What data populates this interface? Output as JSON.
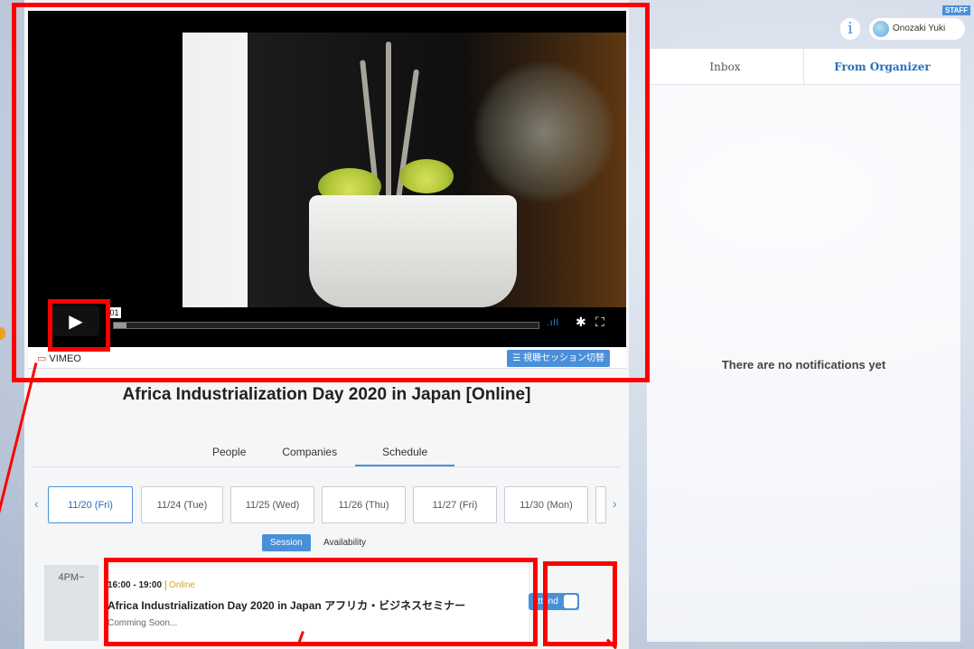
{
  "player": {
    "time_display": ":01",
    "provider_label": "VIMEO",
    "session_switch_label": "☰ 視聴セッション切替"
  },
  "event": {
    "title": "Africa Industrialization Day 2020 in Japan [Online]"
  },
  "tabs": [
    {
      "label": "People",
      "active": false
    },
    {
      "label": "Companies",
      "active": false
    },
    {
      "label": "Schedule",
      "active": true
    }
  ],
  "dates": [
    {
      "label": "11/20 (Fri)",
      "active": true
    },
    {
      "label": "11/24 (Tue)",
      "active": false
    },
    {
      "label": "11/25 (Wed)",
      "active": false
    },
    {
      "label": "11/26 (Thu)",
      "active": false
    },
    {
      "label": "11/27 (Fri)",
      "active": false
    },
    {
      "label": "11/30 (Mon)",
      "active": false
    }
  ],
  "view_toggle": {
    "session_label": "Session",
    "availability_label": "Availability"
  },
  "schedule": {
    "time_slot": "4PM~",
    "session": {
      "time": "16:00 - 19:00",
      "mode": "Online",
      "title": "Africa Industrialization Day 2020 in Japan アフリカ・ビジネスセミナー",
      "status": "Comming Soon..."
    },
    "attend_label": "attend"
  },
  "header": {
    "user_name": "Onozaki Yuki",
    "staff_badge": "STAFF",
    "info_icon": "i"
  },
  "notifications": {
    "tabs": [
      {
        "label": "Inbox",
        "active": false
      },
      {
        "label": "From Organizer",
        "active": true
      }
    ],
    "empty_message": "There are no notifications yet"
  },
  "colors": {
    "accent": "#4a90d9",
    "annotation": "#ff0000",
    "online_tag": "#d9a233"
  }
}
